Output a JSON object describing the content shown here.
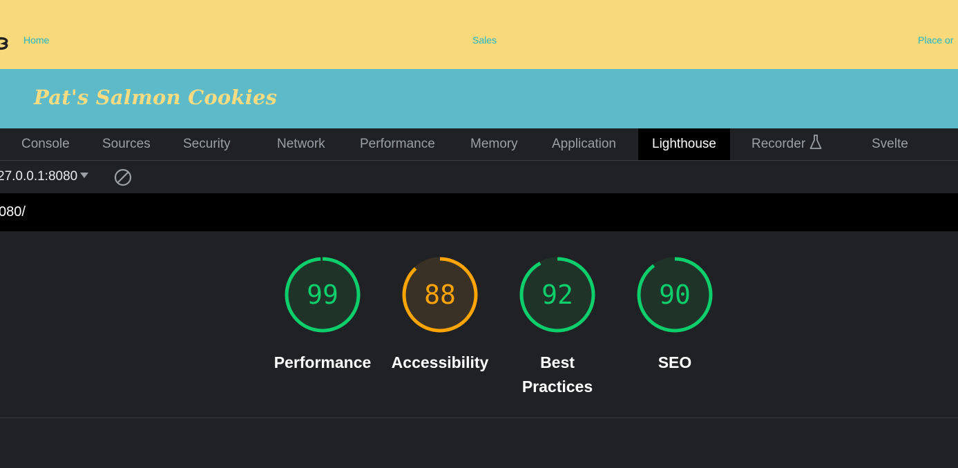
{
  "site": {
    "nav": {
      "home": "Home",
      "sales": "Sales",
      "order": "Place or"
    },
    "title": "Pat's Salmon Cookies"
  },
  "devtools": {
    "tabs": [
      "Console",
      "Sources",
      "Security",
      "Network",
      "Performance",
      "Memory",
      "Application",
      "Lighthouse",
      "Recorder",
      "Svelte"
    ],
    "active_tab": "Lighthouse"
  },
  "lighthouse": {
    "report_select": "27.0.0.1:8080",
    "url": "080/",
    "scores": [
      {
        "label": "Performance",
        "score": 99,
        "color": "#0cce6b",
        "fill": "#1f3328"
      },
      {
        "label": "Accessibility",
        "score": 88,
        "color": "#ffa400",
        "fill": "#3a3126"
      },
      {
        "label": "Best Practices",
        "score": 92,
        "color": "#0cce6b",
        "fill": "#1f3328"
      },
      {
        "label": "SEO",
        "score": 90,
        "color": "#0cce6b",
        "fill": "#1f3328"
      }
    ]
  },
  "colors": {
    "nav_bg": "#f8da7c",
    "banner_bg": "#5dbac9",
    "link": "#27b3c3",
    "pass": "#0cce6b",
    "average": "#ffa400"
  }
}
